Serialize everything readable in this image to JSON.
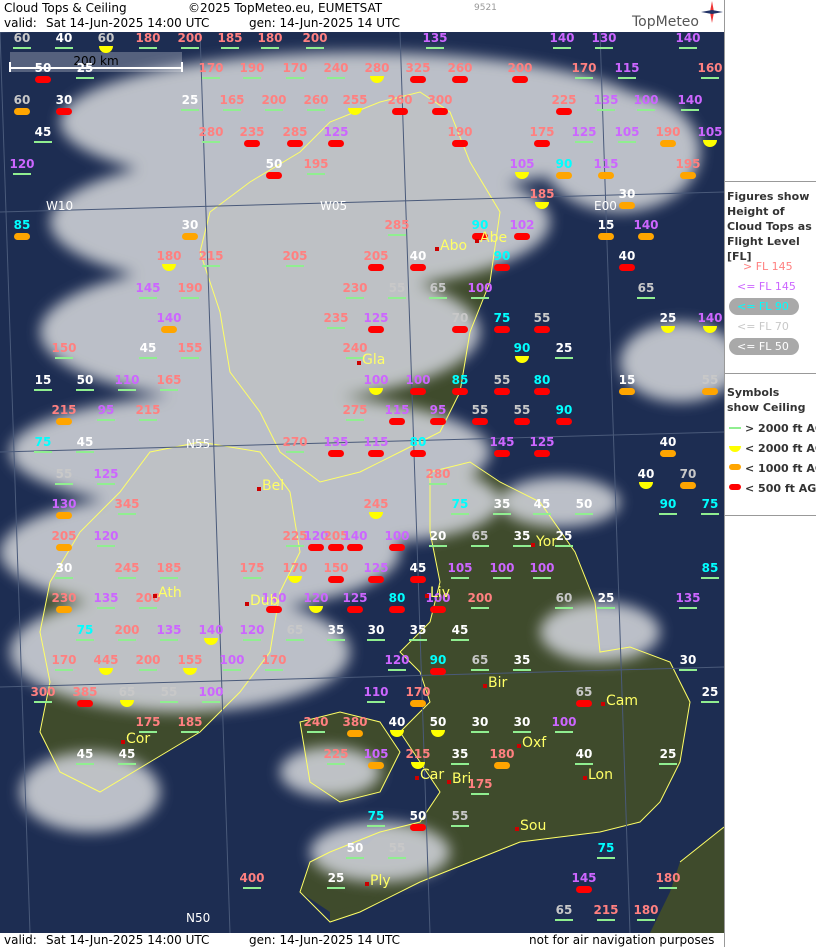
{
  "header": {
    "title": "Cloud Tops & Ceiling",
    "copyright": "©2025 TopMeteo.eu, EUMETSAT",
    "code": "9521",
    "valid_label": "valid:",
    "valid_time": "Sat  14-Jun-2025  14:00 UTC",
    "gen_time": "gen: 14-Jun-2025 14 UTC",
    "logo": "TopMeteo"
  },
  "footer": {
    "valid_label": "valid:",
    "valid_time": "Sat  14-Jun-2025  14:00 UTC",
    "gen_time": "gen: 14-Jun-2025 14 UTC",
    "disclaimer": "not for air navigation purposes"
  },
  "scale_label": "200 km",
  "grid_labels": [
    "W10",
    "W05",
    "E00",
    "N55",
    "N50"
  ],
  "cities": [
    "Abo",
    "Abe",
    "Gla",
    "Bel",
    "Yor",
    "Ath",
    "Dub",
    "Liv",
    "Bir",
    "Cam",
    "Cor",
    "Oxf",
    "Car",
    "Bri",
    "Lon",
    "Sou",
    "Ply"
  ],
  "legend": {
    "figures_title": "Figures show Height of Cloud Tops as Flight Level  [FL]",
    "fl_items": [
      {
        "label": "> FL 145",
        "color": "#ff8080"
      },
      {
        "label": "<= FL 145",
        "color": "#cc66ff"
      },
      {
        "label": "<= FL 90",
        "color": "#00ffff"
      },
      {
        "label": "<= FL 70",
        "color": "#c8c8c8"
      },
      {
        "label": "<= FL 50",
        "color": "#ffffff"
      }
    ],
    "symbols_title": "Symbols show Ceiling",
    "symbol_items": [
      {
        "label": "> 2000 ft AGL",
        "color": "#90ee90",
        "kind": "line"
      },
      {
        "label": "< 2000 ft AGL",
        "color": "#ffff00",
        "kind": "semicircle"
      },
      {
        "label": "< 1000 ft AGL",
        "color": "#ffa500",
        "kind": "pill"
      },
      {
        "label": "< 500 ft AGL",
        "color": "#ff0000",
        "kind": "pill"
      }
    ]
  },
  "colors": {
    "sea": "#1d2d52",
    "land": "#3e4a2c",
    "cloud": "#c9ccd2",
    "coast": "#ffff66",
    "grid": "#4a5a7a"
  },
  "stations": [
    {
      "v": 60,
      "c": "L"
    },
    {
      "v": 40,
      "c": "L"
    },
    {
      "v": 60,
      "c": "Y"
    },
    {
      "v": 180,
      "c": "L"
    },
    {
      "v": 200,
      "c": "L"
    },
    {
      "v": 185,
      "c": "L"
    },
    {
      "v": 180,
      "c": "L"
    },
    {
      "v": 200,
      "c": "L"
    },
    {
      "v": 135,
      "c": "L"
    },
    {
      "v": 140,
      "c": "L"
    },
    {
      "v": 130,
      "c": "L"
    },
    {
      "v": 140,
      "c": "L"
    },
    {
      "v": 50,
      "c": "R"
    },
    {
      "v": 25,
      "c": "L"
    },
    {
      "v": 170,
      "c": "L"
    },
    {
      "v": 190,
      "c": "L"
    },
    {
      "v": 170,
      "c": "L"
    },
    {
      "v": 240,
      "c": "L"
    },
    {
      "v": 280,
      "c": "Y"
    },
    {
      "v": 325,
      "c": "R"
    },
    {
      "v": 260,
      "c": "R"
    },
    {
      "v": 200,
      "c": "R"
    },
    {
      "v": 170,
      "c": "L"
    },
    {
      "v": 115,
      "c": "L"
    },
    {
      "v": 160,
      "c": "L"
    },
    {
      "v": 60,
      "c": "O"
    },
    {
      "v": 30,
      "c": "R"
    },
    {
      "v": 25,
      "c": "L"
    },
    {
      "v": 165,
      "c": "L"
    },
    {
      "v": 200,
      "c": "L"
    },
    {
      "v": 260,
      "c": "L"
    },
    {
      "v": 255,
      "c": "Y"
    },
    {
      "v": 260,
      "c": "R"
    },
    {
      "v": 300,
      "c": "R"
    },
    {
      "v": 225,
      "c": "R"
    },
    {
      "v": 135,
      "c": "L"
    },
    {
      "v": 100,
      "c": "L"
    },
    {
      "v": 140,
      "c": "L"
    },
    {
      "v": 45,
      "c": "L"
    },
    {
      "v": 280,
      "c": "L"
    },
    {
      "v": 235,
      "c": "R"
    },
    {
      "v": 285,
      "c": "R"
    },
    {
      "v": 125,
      "c": "R"
    },
    {
      "v": 190,
      "c": "R"
    },
    {
      "v": 175,
      "c": "R"
    },
    {
      "v": 125,
      "c": "L"
    },
    {
      "v": 105,
      "c": "L"
    },
    {
      "v": 190,
      "c": "O"
    },
    {
      "v": 105,
      "c": "Y"
    },
    {
      "v": 120,
      "c": "L"
    },
    {
      "v": 50,
      "c": "R"
    },
    {
      "v": 195,
      "c": "L"
    },
    {
      "v": 105,
      "c": "Y"
    },
    {
      "v": 90,
      "c": "O"
    },
    {
      "v": 115,
      "c": "O"
    },
    {
      "v": 195,
      "c": "O"
    },
    {
      "v": 85,
      "c": "O"
    },
    {
      "v": 30,
      "c": "O"
    },
    {
      "v": 285,
      "c": "L"
    },
    {
      "v": 90,
      "c": "R"
    },
    {
      "v": 102,
      "c": "R"
    },
    {
      "v": 15,
      "c": "O"
    },
    {
      "v": 140,
      "c": "O"
    },
    {
      "v": 185,
      "c": "Y"
    },
    {
      "v": 30,
      "c": "O"
    },
    {
      "v": 180,
      "c": "Y"
    },
    {
      "v": 215,
      "c": "L"
    },
    {
      "v": 205,
      "c": "L"
    },
    {
      "v": 205,
      "c": "R"
    },
    {
      "v": 40,
      "c": "R"
    },
    {
      "v": 90,
      "c": "R"
    },
    {
      "v": 40,
      "c": "R"
    },
    {
      "v": 145,
      "c": "L"
    },
    {
      "v": 190,
      "c": "L"
    },
    {
      "v": 230,
      "c": "L"
    },
    {
      "v": 55,
      "c": "L"
    },
    {
      "v": 65,
      "c": "L"
    },
    {
      "v": 100,
      "c": "L"
    },
    {
      "v": 65,
      "c": "L"
    },
    {
      "v": 140,
      "c": "O"
    },
    {
      "v": 235,
      "c": "L"
    },
    {
      "v": 125,
      "c": "R"
    },
    {
      "v": 70,
      "c": "R"
    },
    {
      "v": 75,
      "c": "R"
    },
    {
      "v": 55,
      "c": "R"
    },
    {
      "v": 25,
      "c": "Y"
    },
    {
      "v": 140,
      "c": "Y"
    },
    {
      "v": 150,
      "c": "L"
    },
    {
      "v": 45,
      "c": "L"
    },
    {
      "v": 155,
      "c": "L"
    },
    {
      "v": 240,
      "c": "L"
    },
    {
      "v": 90,
      "c": "Y"
    },
    {
      "v": 25,
      "c": "L"
    },
    {
      "v": 15,
      "c": "L"
    },
    {
      "v": 50,
      "c": "L"
    },
    {
      "v": 110,
      "c": "L"
    },
    {
      "v": 165,
      "c": "L"
    },
    {
      "v": 100,
      "c": "Y"
    },
    {
      "v": 100,
      "c": "R"
    },
    {
      "v": 85,
      "c": "R"
    },
    {
      "v": 55,
      "c": "R"
    },
    {
      "v": 80,
      "c": "R"
    },
    {
      "v": 15,
      "c": "O"
    },
    {
      "v": 55,
      "c": "O"
    },
    {
      "v": 215,
      "c": "O"
    },
    {
      "v": 95,
      "c": "L"
    },
    {
      "v": 215,
      "c": "L"
    },
    {
      "v": 275,
      "c": "L"
    },
    {
      "v": 115,
      "c": "R"
    },
    {
      "v": 95,
      "c": "R"
    },
    {
      "v": 55,
      "c": "R"
    },
    {
      "v": 55,
      "c": "R"
    },
    {
      "v": 90,
      "c": "R"
    },
    {
      "v": 75,
      "c": "L"
    },
    {
      "v": 45,
      "c": "L"
    },
    {
      "v": 270,
      "c": "L"
    },
    {
      "v": 135,
      "c": "R"
    },
    {
      "v": 115,
      "c": "R"
    },
    {
      "v": 80,
      "c": "R"
    },
    {
      "v": 145,
      "c": "R"
    },
    {
      "v": 125,
      "c": "R"
    },
    {
      "v": 40,
      "c": "O"
    },
    {
      "v": 55,
      "c": "L"
    },
    {
      "v": 125,
      "c": "L"
    },
    {
      "v": 280,
      "c": "L"
    },
    {
      "v": 40,
      "c": "Y"
    },
    {
      "v": 70,
      "c": "O"
    },
    {
      "v": 130,
      "c": "O"
    },
    {
      "v": 345,
      "c": "L"
    },
    {
      "v": 245,
      "c": "Y"
    },
    {
      "v": 75,
      "c": "L"
    },
    {
      "v": 35,
      "c": "L"
    },
    {
      "v": 45,
      "c": "L"
    },
    {
      "v": 50,
      "c": "L"
    },
    {
      "v": 90,
      "c": "L"
    },
    {
      "v": 75,
      "c": "L"
    },
    {
      "v": 205,
      "c": "O"
    },
    {
      "v": 120,
      "c": "L"
    },
    {
      "v": 225,
      "c": "L"
    },
    {
      "v": 120,
      "c": "R"
    },
    {
      "v": 205,
      "c": "R"
    },
    {
      "v": 140,
      "c": "R"
    },
    {
      "v": 100,
      "c": "R"
    },
    {
      "v": 20,
      "c": "L"
    },
    {
      "v": 65,
      "c": "L"
    },
    {
      "v": 35,
      "c": "L"
    },
    {
      "v": 25,
      "c": "L"
    },
    {
      "v": 30,
      "c": "L"
    },
    {
      "v": 245,
      "c": "L"
    },
    {
      "v": 185,
      "c": "L"
    },
    {
      "v": 175,
      "c": "L"
    },
    {
      "v": 170,
      "c": "Y"
    },
    {
      "v": 150,
      "c": "R"
    },
    {
      "v": 125,
      "c": "R"
    },
    {
      "v": 45,
      "c": "R"
    },
    {
      "v": 105,
      "c": "L"
    },
    {
      "v": 100,
      "c": "L"
    },
    {
      "v": 100,
      "c": "L"
    },
    {
      "v": 85,
      "c": "L"
    },
    {
      "v": 230,
      "c": "O"
    },
    {
      "v": 135,
      "c": "L"
    },
    {
      "v": 200,
      "c": "L"
    },
    {
      "v": 140,
      "c": "R"
    },
    {
      "v": 120,
      "c": "Y"
    },
    {
      "v": 125,
      "c": "R"
    },
    {
      "v": 80,
      "c": "R"
    },
    {
      "v": 100,
      "c": "R"
    },
    {
      "v": 200,
      "c": "L"
    },
    {
      "v": 60,
      "c": "L"
    },
    {
      "v": 25,
      "c": "L"
    },
    {
      "v": 135,
      "c": "L"
    },
    {
      "v": 75,
      "c": "L"
    },
    {
      "v": 200,
      "c": "L"
    },
    {
      "v": 135,
      "c": "L"
    },
    {
      "v": 140,
      "c": "Y"
    },
    {
      "v": 120,
      "c": "L"
    },
    {
      "v": 65,
      "c": "L"
    },
    {
      "v": 35,
      "c": "L"
    },
    {
      "v": 30,
      "c": "L"
    },
    {
      "v": 35,
      "c": "L"
    },
    {
      "v": 45,
      "c": "L"
    },
    {
      "v": 170,
      "c": "L"
    },
    {
      "v": 445,
      "c": "Y"
    },
    {
      "v": 200,
      "c": "L"
    },
    {
      "v": 155,
      "c": "Y"
    },
    {
      "v": 100,
      "c": "L"
    },
    {
      "v": 170,
      "c": "L"
    },
    {
      "v": 120,
      "c": "L"
    },
    {
      "v": 90,
      "c": "R"
    },
    {
      "v": 65,
      "c": "L"
    },
    {
      "v": 35,
      "c": "L"
    },
    {
      "v": 30,
      "c": "L"
    },
    {
      "v": 300,
      "c": "L"
    },
    {
      "v": 385,
      "c": "R"
    },
    {
      "v": 65,
      "c": "Y"
    },
    {
      "v": 55,
      "c": "L"
    },
    {
      "v": 100,
      "c": "L"
    },
    {
      "v": 110,
      "c": "L"
    },
    {
      "v": 170,
      "c": "O"
    },
    {
      "v": 65,
      "c": "R"
    },
    {
      "v": 25,
      "c": "L"
    },
    {
      "v": 175,
      "c": "L"
    },
    {
      "v": 185,
      "c": "L"
    },
    {
      "v": 240,
      "c": "L"
    },
    {
      "v": 380,
      "c": "O"
    },
    {
      "v": 40,
      "c": "Y"
    },
    {
      "v": 50,
      "c": "Y"
    },
    {
      "v": 30,
      "c": "L"
    },
    {
      "v": 30,
      "c": "L"
    },
    {
      "v": 100,
      "c": "L"
    },
    {
      "v": 45,
      "c": "L"
    },
    {
      "v": 45,
      "c": "L"
    },
    {
      "v": 225,
      "c": "L"
    },
    {
      "v": 105,
      "c": "O"
    },
    {
      "v": 215,
      "c": "Y"
    },
    {
      "v": 35,
      "c": "L"
    },
    {
      "v": 180,
      "c": "O"
    },
    {
      "v": 40,
      "c": "L"
    },
    {
      "v": 25,
      "c": "L"
    },
    {
      "v": 175,
      "c": "L"
    },
    {
      "v": 75,
      "c": "L"
    },
    {
      "v": 50,
      "c": "R"
    },
    {
      "v": 55,
      "c": "L"
    },
    {
      "v": 50,
      "c": "L"
    },
    {
      "v": 55,
      "c": "L"
    },
    {
      "v": 75,
      "c": "L"
    },
    {
      "v": 400,
      "c": "L"
    },
    {
      "v": 25,
      "c": "L"
    },
    {
      "v": 145,
      "c": "R"
    },
    {
      "v": 180,
      "c": "L"
    },
    {
      "v": 65,
      "c": "L"
    },
    {
      "v": 215,
      "c": "L"
    },
    {
      "v": 180,
      "c": "L"
    },
    {
      "v": 175,
      "c": "O"
    }
  ]
}
